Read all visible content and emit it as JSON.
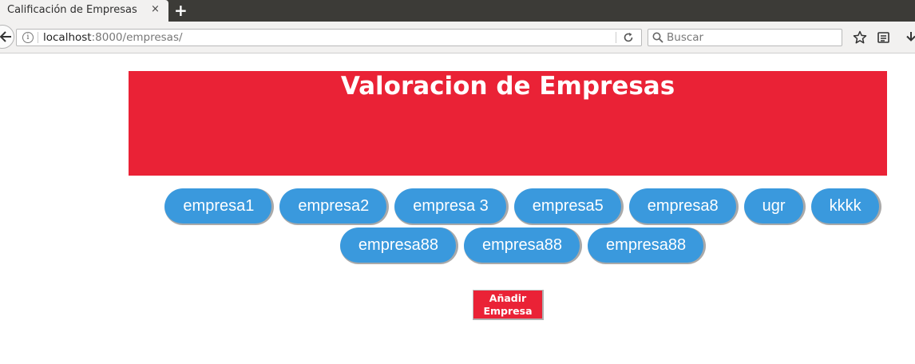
{
  "browser": {
    "tab_title": "Calificación de Empresas",
    "tab_close": "×",
    "new_tab": "+",
    "url_host": "localhost",
    "url_rest": ":8000/empresas/",
    "search_placeholder": "Buscar"
  },
  "page": {
    "title": "Valoracion de Empresas",
    "companies": [
      "empresa1",
      "empresa2",
      "empresa 3",
      "empresa5",
      "empresa8",
      "ugr",
      "kkkk",
      "empresa88",
      "empresa88",
      "empresa88"
    ],
    "add_button": [
      "Añadir",
      "Empresa"
    ]
  },
  "colors": {
    "header_red": "#ea2236",
    "button_blue": "#3a99dd"
  }
}
